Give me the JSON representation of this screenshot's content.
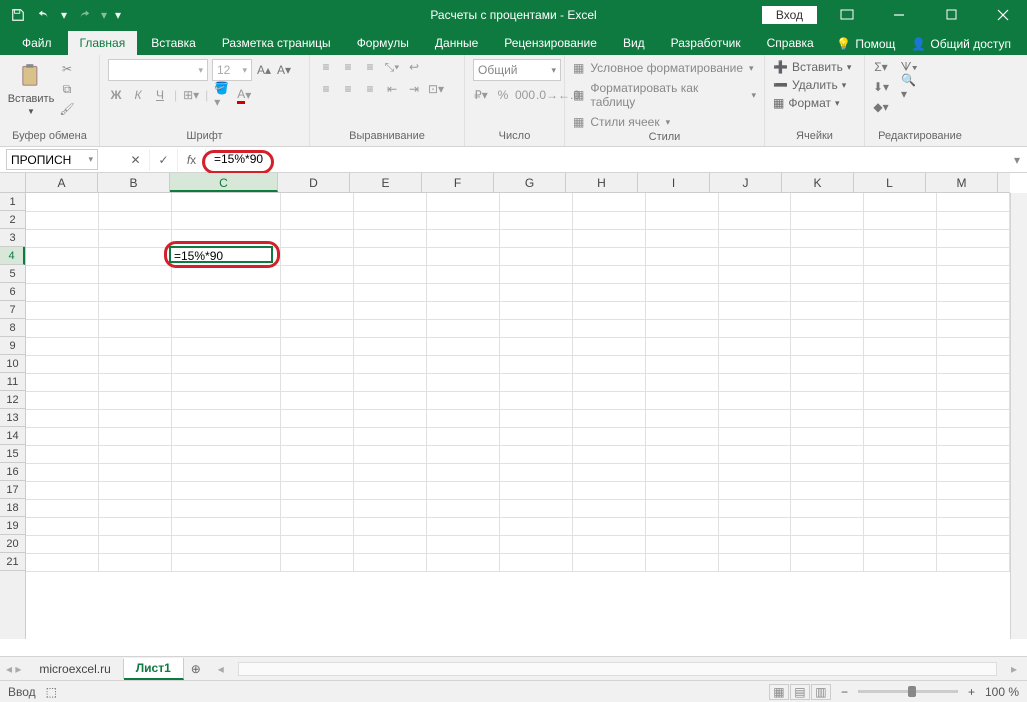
{
  "title": "Расчеты с процентами  -  Excel",
  "login": "Вход",
  "tabs": {
    "file": "Файл",
    "home": "Главная",
    "insert": "Вставка",
    "layout": "Разметка страницы",
    "formulas": "Формулы",
    "data": "Данные",
    "review": "Рецензирование",
    "view": "Вид",
    "developer": "Разработчик",
    "help": "Справка"
  },
  "help_search": "Помощ",
  "share": "Общий доступ",
  "ribbon": {
    "clipboard": {
      "label": "Буфер обмена",
      "paste": "Вставить"
    },
    "font": {
      "label": "Шрифт",
      "size": "12"
    },
    "alignment": {
      "label": "Выравнивание"
    },
    "number": {
      "label": "Число",
      "format": "Общий"
    },
    "styles": {
      "label": "Стили",
      "cond": "Условное форматирование",
      "table": "Форматировать как таблицу",
      "cell": "Стили ячеек"
    },
    "cells": {
      "label": "Ячейки",
      "insert": "Вставить",
      "delete": "Удалить",
      "format": "Формат"
    },
    "editing": {
      "label": "Редактирование"
    }
  },
  "namebox": "ПРОПИСН",
  "formula": "=15%*90",
  "active_cell_value": "=15%*90",
  "columns": [
    "A",
    "B",
    "C",
    "D",
    "E",
    "F",
    "G",
    "H",
    "I",
    "J",
    "K",
    "L",
    "M"
  ],
  "rows": [
    "1",
    "2",
    "3",
    "4",
    "5",
    "6",
    "7",
    "8",
    "9",
    "10",
    "11",
    "12",
    "13",
    "14",
    "15",
    "16",
    "17",
    "18",
    "19",
    "20",
    "21"
  ],
  "sheets": {
    "s1": "microexcel.ru",
    "s2": "Лист1"
  },
  "status": "Ввод",
  "zoom": "100 %"
}
